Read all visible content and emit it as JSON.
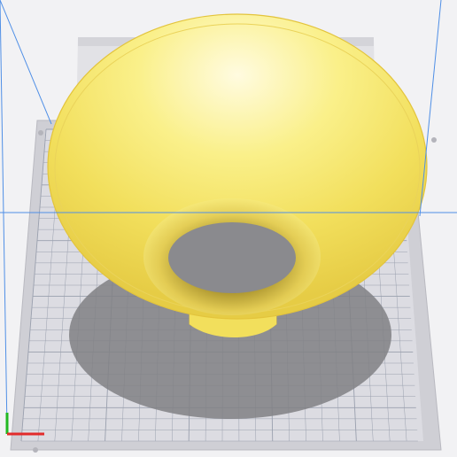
{
  "viewport": {
    "kind": "slicer-3d-preview",
    "model": {
      "shape": "flared-funnel",
      "color": "#f4e46a",
      "highlight": "#fffbe0",
      "edge_color": "#e3c43c"
    },
    "build_plate": {
      "grid": true,
      "plate_color": "#d8d8de",
      "grid_line_color": "#9aa0ae",
      "shadow_color": "#7e7e82"
    },
    "view_guides": {
      "color": "#4f8fe6"
    },
    "axis_gizmo": {
      "x_axis_color": "#e22b2b",
      "y_axis_color": "#22b822",
      "z_axis_color": "#3377e0"
    }
  }
}
